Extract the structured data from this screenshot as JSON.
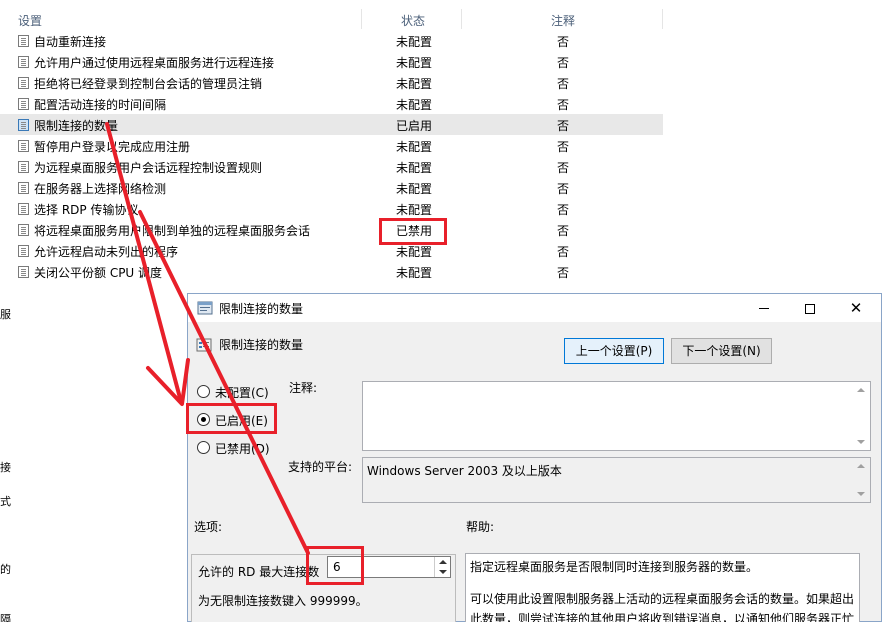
{
  "list": {
    "columns": {
      "setting": "设置",
      "state": "状态",
      "note": "注释"
    },
    "rows": [
      {
        "name": "自动重新连接",
        "state": "未配置",
        "note": "否"
      },
      {
        "name": "允许用户通过使用远程桌面服务进行远程连接",
        "state": "未配置",
        "note": "否"
      },
      {
        "name": "拒绝将已经登录到控制台会话的管理员注销",
        "state": "未配置",
        "note": "否"
      },
      {
        "name": "配置活动连接的时间间隔",
        "state": "未配置",
        "note": "否"
      },
      {
        "name": "限制连接的数量",
        "state": "已启用",
        "note": "否"
      },
      {
        "name": "暂停用户登录以完成应用注册",
        "state": "未配置",
        "note": "否"
      },
      {
        "name": "为远程桌面服务用户会话远程控制设置规则",
        "state": "未配置",
        "note": "否"
      },
      {
        "name": "在服务器上选择网络检测",
        "state": "未配置",
        "note": "否"
      },
      {
        "name": "选择 RDP 传输协议",
        "state": "未配置",
        "note": "否"
      },
      {
        "name": "将远程桌面服务用户限制到单独的远程桌面服务会话",
        "state": "已禁用",
        "note": "否"
      },
      {
        "name": "允许远程启动未列出的程序",
        "state": "未配置",
        "note": "否"
      },
      {
        "name": "关闭公平份额 CPU 调度",
        "state": "未配置",
        "note": "否"
      }
    ],
    "left_fragments": [
      "服",
      "接",
      "式",
      "的",
      "隔"
    ]
  },
  "dialog": {
    "window_title": "限制连接的数量",
    "heading": "限制连接的数量",
    "prev_button": "上一个设置(P)",
    "next_button": "下一个设置(N)",
    "radios": {
      "not_configured": "未配置(C)",
      "enabled": "已启用(E)",
      "disabled": "已禁用(D)"
    },
    "selected_radio": "enabled",
    "comment_label": "注释:",
    "comment_value": "",
    "platform_label": "支持的平台:",
    "platform_value": "Windows Server 2003 及以上版本",
    "options_label": "选项:",
    "help_label": "帮助:",
    "options": {
      "max_connections_label": "允许的 RD 最大连接数",
      "max_connections_value": "6",
      "hint": "为无限制连接数键入 999999。"
    },
    "help_lines": [
      "指定远程桌面服务是否限制同时连接到服务器的数量。",
      "可以使用此设置限制服务器上活动的远程桌面服务会话的数量。如果超出",
      "此数量，则尝试连接的其他用户将收到错误消息，以通知他们服务器正忙"
    ]
  },
  "colors": {
    "highlight": "#e8202a",
    "header_text": "#4c607a",
    "selected_row": "#e8e8e8"
  }
}
